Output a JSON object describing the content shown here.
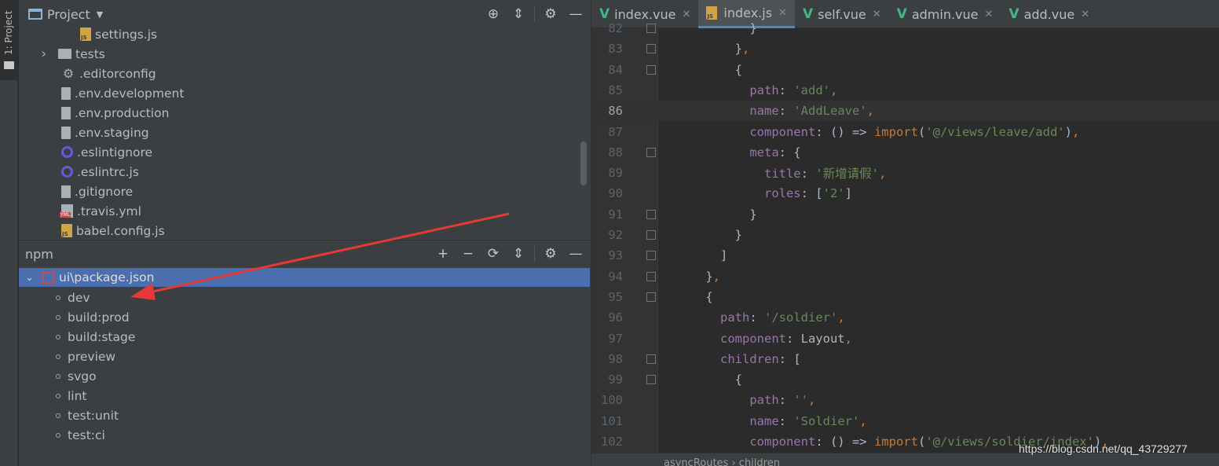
{
  "tool_strip": {
    "tab_label": "1: Project"
  },
  "project_panel": {
    "title": "Project",
    "tools": [
      "crosshair-icon",
      "collapse-icon",
      "gear-icon",
      "minimize-icon"
    ],
    "tree": [
      {
        "label": "settings.js",
        "icon": "js-file-icon",
        "indent": 2
      },
      {
        "label": "tests",
        "icon": "folder-icon",
        "indent": 1,
        "collapsible": true
      },
      {
        "label": ".editorconfig",
        "icon": "gear-icon",
        "indent": 1
      },
      {
        "label": ".env.development",
        "icon": "doc-icon",
        "indent": 1
      },
      {
        "label": ".env.production",
        "icon": "doc-icon",
        "indent": 1
      },
      {
        "label": ".env.staging",
        "icon": "doc-icon",
        "indent": 1
      },
      {
        "label": ".eslintignore",
        "icon": "eslint-icon",
        "indent": 1
      },
      {
        "label": ".eslintrc.js",
        "icon": "eslint-icon",
        "indent": 1
      },
      {
        "label": ".gitignore",
        "icon": "doc-icon",
        "indent": 1
      },
      {
        "label": ".travis.yml",
        "icon": "yml-icon",
        "indent": 1
      },
      {
        "label": "babel.config.js",
        "icon": "js-file-icon",
        "indent": 1
      }
    ]
  },
  "npm_panel": {
    "title": "npm",
    "package": "ui\\package.json",
    "scripts": [
      "dev",
      "build:prod",
      "build:stage",
      "preview",
      "svgo",
      "lint",
      "test:unit",
      "test:ci"
    ]
  },
  "editor": {
    "tabs": [
      {
        "label": "index.vue",
        "icon": "vue-icon",
        "active": false
      },
      {
        "label": "index.js",
        "icon": "js-file-icon",
        "active": true
      },
      {
        "label": "self.vue",
        "icon": "vue-icon",
        "active": false
      },
      {
        "label": "admin.vue",
        "icon": "vue-icon",
        "active": false
      },
      {
        "label": "add.vue",
        "icon": "vue-icon",
        "active": false
      }
    ],
    "current_line": 86,
    "lines": [
      {
        "n": "82",
        "tokens": [
          [
            "t-plain",
            "          }"
          ]
        ]
      },
      {
        "n": "83",
        "tokens": [
          [
            "t-plain",
            "        }"
          ],
          [
            "t-kw",
            ","
          ]
        ]
      },
      {
        "n": "84",
        "tokens": [
          [
            "t-plain",
            "        {"
          ]
        ]
      },
      {
        "n": "85",
        "tokens": [
          [
            "t-key",
            "          path"
          ],
          [
            "t-plain",
            ": "
          ],
          [
            "t-str",
            "'add'"
          ],
          [
            "t-kw",
            ","
          ]
        ]
      },
      {
        "n": "86",
        "tokens": [
          [
            "t-key",
            "          name"
          ],
          [
            "t-plain",
            ": "
          ],
          [
            "t-str",
            "'AddLeave'"
          ],
          [
            "t-kw",
            ","
          ]
        ]
      },
      {
        "n": "87",
        "tokens": [
          [
            "t-key",
            "          component"
          ],
          [
            "t-plain",
            ": () => "
          ],
          [
            "t-kw",
            "import"
          ],
          [
            "t-plain",
            "("
          ],
          [
            "t-str",
            "'@/views/leave/add'"
          ],
          [
            "t-plain",
            ")"
          ],
          [
            "t-kw",
            ","
          ]
        ]
      },
      {
        "n": "88",
        "tokens": [
          [
            "t-key",
            "          meta"
          ],
          [
            "t-plain",
            ": {"
          ]
        ]
      },
      {
        "n": "89",
        "tokens": [
          [
            "t-key",
            "            title"
          ],
          [
            "t-plain",
            ": "
          ],
          [
            "t-str",
            "'新增请假'"
          ],
          [
            "t-kw",
            ","
          ]
        ]
      },
      {
        "n": "90",
        "tokens": [
          [
            "t-key",
            "            roles"
          ],
          [
            "t-plain",
            ": ["
          ],
          [
            "t-str",
            "'2'"
          ],
          [
            "t-plain",
            "]"
          ]
        ]
      },
      {
        "n": "91",
        "tokens": [
          [
            "t-plain",
            "          }"
          ]
        ]
      },
      {
        "n": "92",
        "tokens": [
          [
            "t-plain",
            "        }"
          ]
        ]
      },
      {
        "n": "93",
        "tokens": [
          [
            "t-plain",
            "      ]"
          ]
        ]
      },
      {
        "n": "94",
        "tokens": [
          [
            "t-plain",
            "    }"
          ],
          [
            "t-kw",
            ","
          ]
        ]
      },
      {
        "n": "95",
        "tokens": [
          [
            "t-plain",
            "    {"
          ]
        ]
      },
      {
        "n": "96",
        "tokens": [
          [
            "t-key",
            "      path"
          ],
          [
            "t-plain",
            ": "
          ],
          [
            "t-str",
            "'/soldier'"
          ],
          [
            "t-kw",
            ","
          ]
        ]
      },
      {
        "n": "97",
        "tokens": [
          [
            "t-key",
            "      component"
          ],
          [
            "t-plain",
            ": Layout"
          ],
          [
            "t-kw",
            ","
          ]
        ]
      },
      {
        "n": "98",
        "tokens": [
          [
            "t-key",
            "      children"
          ],
          [
            "t-plain",
            ": ["
          ]
        ]
      },
      {
        "n": "99",
        "tokens": [
          [
            "t-plain",
            "        {"
          ]
        ]
      },
      {
        "n": "100",
        "tokens": [
          [
            "t-key",
            "          path"
          ],
          [
            "t-plain",
            ": "
          ],
          [
            "t-str",
            "''"
          ],
          [
            "t-kw",
            ","
          ]
        ]
      },
      {
        "n": "101",
        "tokens": [
          [
            "t-key",
            "          name"
          ],
          [
            "t-plain",
            ": "
          ],
          [
            "t-str",
            "'Soldier'"
          ],
          [
            "t-kw",
            ","
          ]
        ]
      },
      {
        "n": "102",
        "tokens": [
          [
            "t-key",
            "          component"
          ],
          [
            "t-plain",
            ": () => "
          ],
          [
            "t-kw",
            "import"
          ],
          [
            "t-plain",
            "("
          ],
          [
            "t-str",
            "'@/views/soldier/index'"
          ],
          [
            "t-plain",
            ")"
          ],
          [
            "t-kw",
            ","
          ]
        ]
      }
    ],
    "breadcrumb": "asyncRoutes  ›  children"
  },
  "watermark": "https://blog.csdn.net/qq_43729277",
  "colors": {
    "accent": "#4b6eaf",
    "arrow": "#e53935",
    "vue": "#41b883"
  }
}
